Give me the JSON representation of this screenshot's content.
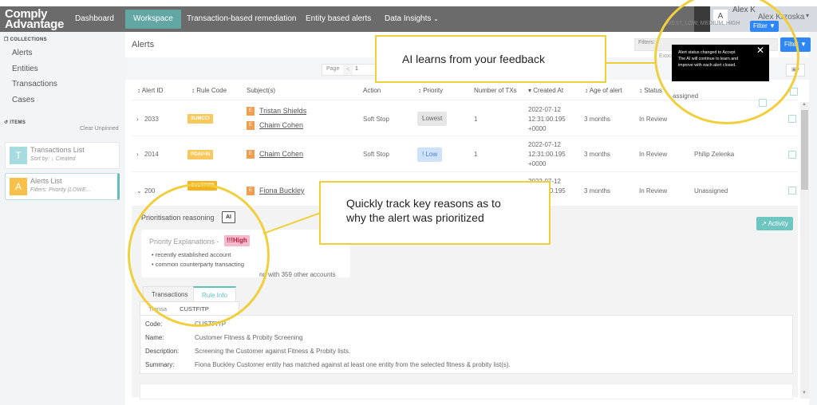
{
  "app": {
    "logo_line1": "Comply",
    "logo_line2": "Advantage"
  },
  "nav": {
    "items": [
      {
        "label": "Dashboard"
      },
      {
        "label": "Workspace",
        "active": true
      },
      {
        "label": "Transaction-based remediation"
      },
      {
        "label": "Entity based alerts"
      },
      {
        "label": "Data Insights ⌵"
      }
    ],
    "data_insights_label": "Data Insights",
    "chevron": "⌄"
  },
  "user": {
    "avatar_letter": "A",
    "name_partial": "Alex K",
    "name_full": "Alex Krzoska",
    "caret": "▾"
  },
  "sidebar": {
    "collections_title": "COLLECTIONS",
    "collections": [
      "Alerts",
      "Entities",
      "Transactions",
      "Cases"
    ],
    "items_title": "ITEMS",
    "clear_unpinned": "Clear Unpinned",
    "pinned": [
      {
        "letter": "T",
        "title": "Transactions List",
        "subtitle": "Sort by: ↓ Created",
        "color": "#a6dbe0"
      },
      {
        "letter": "A",
        "title": "Alerts List",
        "subtitle": "Filters: Priority (LOWE...",
        "color": "#f7c04a"
      }
    ]
  },
  "main": {
    "title": "Alerts",
    "filters_label": "Filters:",
    "filter_value": "WEST, LOW, MEDIUM, HIGH",
    "filter_button": "Filter ▼",
    "export_partial": "Expo",
    "pager_label": "Page",
    "pager_prev": "<",
    "pager_current": "1"
  },
  "table": {
    "columns": [
      "↕ Alert ID",
      "↕ Rule Code",
      "Subject(s)",
      "Action",
      "↕ Priority",
      "Number of TXs",
      "▾ Created At",
      "↕ Age of alert",
      "↕ Status"
    ],
    "rows": [
      {
        "id": "2033",
        "toggle": "›",
        "rule": "SUMCCI",
        "rule_color": "#f9c85a",
        "subjects": [
          "Tristan Shields",
          "Chaim Cohen"
        ],
        "action": "Soft Stop",
        "priority": "Lowest",
        "priority_bg": "#e6e6e6",
        "priority_fg": "#666",
        "txs": "1",
        "created": [
          "2022-07-12",
          "12:31:00.195",
          "+0000"
        ],
        "age": "3 months",
        "status": "In Review",
        "assignee": "Unassigned"
      },
      {
        "id": "2014",
        "toggle": "›",
        "rule": "PGAV-IN",
        "rule_color": "#f9c85a",
        "subjects": [
          "Chaim Cohen"
        ],
        "action": "Soft Stop",
        "priority": "! Low",
        "priority_bg": "#cfe2fb",
        "priority_fg": "#4a7fc1",
        "txs": "1",
        "created": [
          "2022-07-12",
          "12:31:00.195",
          "+0000"
        ],
        "age": "3 months",
        "status": "In Review",
        "assignee": "Philip Zelenka"
      },
      {
        "id": "200",
        "toggle": "⌄",
        "rule": "CUSTFITP",
        "rule_color": "#f5b321",
        "subjects": [
          "Fiona Buckley"
        ],
        "action": "",
        "priority": "",
        "txs": "",
        "created": [
          "2022-07-12",
          "12:31:00.195",
          ""
        ],
        "age": "3 months",
        "status": "In Review",
        "assignee": "Unassigned"
      }
    ],
    "entity_letter": "E"
  },
  "expanded": {
    "reasoning_label": "Prioritisation reasoning",
    "ai_tag": "AI",
    "priority_explanations": "Priority Explanations -",
    "high_badge": "!!!High",
    "bullets": [
      "recently established account",
      "common counterparty transacting"
    ],
    "bullet_extra": "ng with 359 other accounts",
    "activity_button": "↗ Activity",
    "tabs": [
      "Transactions",
      "Rule Info"
    ],
    "subtab_partial": "Transa",
    "subtab_code": "CUSTFITP",
    "rule_info": [
      {
        "label": "Code:",
        "value": "CUSTFITP"
      },
      {
        "label": "Name:",
        "value": "Customer Fitness & Probity Screening"
      },
      {
        "label": "Description:",
        "value": "Screening the Customer against Fitness & Probity lists."
      },
      {
        "label": "Summary:",
        "value": "Fiona Buckley Customer entity has matched against at least one entity from the selected fitness & probity list(s)."
      }
    ]
  },
  "toast": {
    "line1": "Alert status changed to Accept",
    "line2": "The AI will continue to learn and",
    "line3": "improve with each alert closed.",
    "close": "✕"
  },
  "callouts": {
    "top": "AI learns from your feedback",
    "middle_line1": "Quickly track key reasons as to",
    "middle_line2": "why the alert was prioritized"
  },
  "colors": {
    "accent_teal": "#62a7a3",
    "filter_blue": "#2f86f5",
    "callout_yellow": "#f0cf3e"
  }
}
